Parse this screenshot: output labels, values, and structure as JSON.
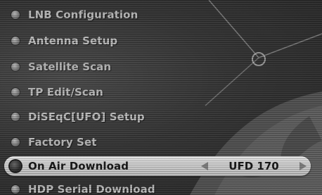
{
  "menu": {
    "items": [
      {
        "label": "LNB Configuration"
      },
      {
        "label": "Antenna Setup"
      },
      {
        "label": "Satellite Scan"
      },
      {
        "label": "TP Edit/Scan"
      },
      {
        "label": "DiSEqC[UFO] Setup"
      },
      {
        "label": "Factory Set"
      },
      {
        "label": "On Air Download",
        "selected": true,
        "value": "UFD 170"
      },
      {
        "label": "HDP Serial Download"
      }
    ]
  }
}
